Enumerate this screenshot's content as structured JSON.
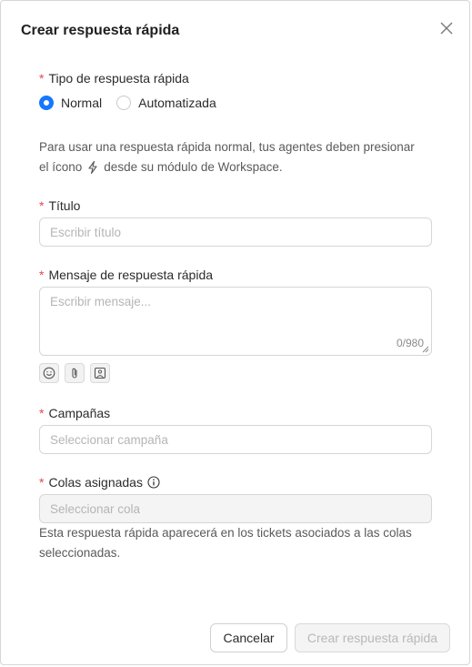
{
  "modal": {
    "title": "Crear respuesta rápida"
  },
  "type_field": {
    "required_mark": "*",
    "label": "Tipo de respuesta rápida",
    "options": [
      {
        "label": "Normal",
        "selected": true
      },
      {
        "label": "Automatizada",
        "selected": false
      }
    ],
    "help_line1": "Para usar una respuesta rápida normal, tus agentes deben presionar",
    "help_line2_before": "el ícono",
    "help_line2_after": "desde su módulo de Workspace."
  },
  "title_field": {
    "required_mark": "*",
    "label": "Título",
    "placeholder": "Escribir título"
  },
  "message_field": {
    "required_mark": "*",
    "label": "Mensaje de respuesta rápida",
    "placeholder": "Escribir mensaje...",
    "counter": "0/980",
    "tools": [
      "emoji-icon",
      "paperclip-icon",
      "image-icon"
    ]
  },
  "campaigns_field": {
    "required_mark": "*",
    "label": "Campañas",
    "placeholder": "Seleccionar campaña"
  },
  "queues_field": {
    "required_mark": "*",
    "label": "Colas asignadas",
    "placeholder": "Seleccionar cola",
    "help_line1": "Esta respuesta rápida aparecerá en los tickets asociados a las colas",
    "help_line2": "seleccionadas."
  },
  "footer": {
    "cancel_label": "Cancelar",
    "submit_label": "Crear respuesta rápida"
  },
  "colors": {
    "accent": "#1677ff",
    "required": "#e5484d"
  }
}
